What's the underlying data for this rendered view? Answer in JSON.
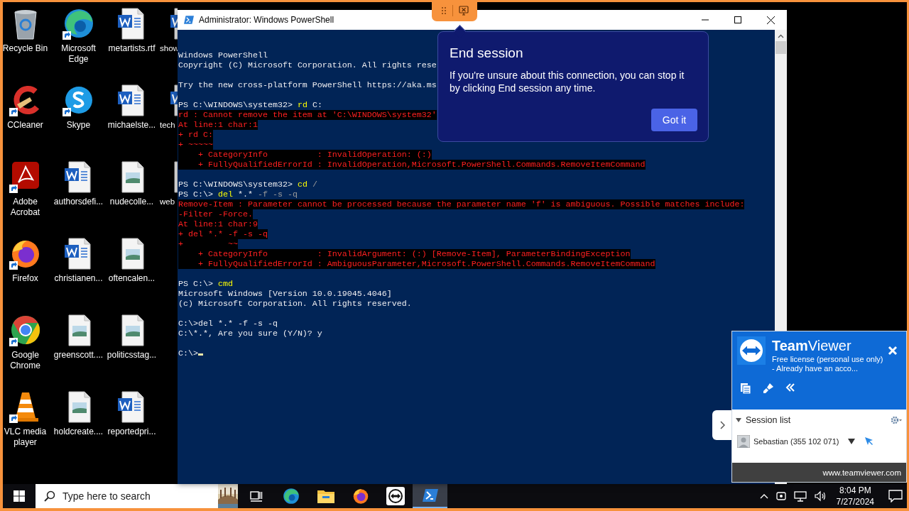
{
  "desktop": {
    "icons": [
      {
        "label": "Recycle Bin",
        "kind": "recycle",
        "shortcut": false
      },
      {
        "label": "CCleaner",
        "kind": "ccleaner",
        "shortcut": true
      },
      {
        "label": "Adobe Acrobat",
        "kind": "acrobat",
        "shortcut": true
      },
      {
        "label": "Firefox",
        "kind": "firefox",
        "shortcut": true
      },
      {
        "label": "Google Chrome",
        "kind": "chrome",
        "shortcut": true
      },
      {
        "label": "VLC media player",
        "kind": "vlc",
        "shortcut": true
      },
      {
        "label": "Microsoft Edge",
        "kind": "edge",
        "shortcut": true
      },
      {
        "label": "Skype",
        "kind": "skype",
        "shortcut": true
      },
      {
        "label": "authorsdefi...",
        "kind": "word",
        "shortcut": false
      },
      {
        "label": "christianen...",
        "kind": "word",
        "shortcut": false
      },
      {
        "label": "greenscott....",
        "shortcut": false
      },
      {
        "label": "holdcreate....",
        "shortcut": false
      },
      {
        "label": "metartists.rtf",
        "kind": "word",
        "shortcut": false
      },
      {
        "label": "michaelste...",
        "kind": "word",
        "shortcut": false
      },
      {
        "label": "nudecolle...",
        "shortcut": false
      },
      {
        "label": "oftencalen...",
        "shortcut": false
      },
      {
        "label": "politicsstag...",
        "shortcut": false
      },
      {
        "label": "reportedpri...",
        "kind": "word",
        "shortcut": false
      },
      {
        "label": "show",
        "kind": "word",
        "shortcut": false
      },
      {
        "label": "tech",
        "kind": "word",
        "shortcut": false
      },
      {
        "label": "web",
        "shortcut": false
      }
    ]
  },
  "powershell": {
    "title": "Administrator: Windows PowerShell",
    "cursor": true,
    "lines": [
      {
        "kind": "text",
        "spans": [
          {
            "text": "Windows PowerShell",
            "kind": "plain"
          }
        ]
      },
      {
        "kind": "text",
        "spans": [
          {
            "text": "Copyright (C) Microsoft Corporation. All rights rese",
            "kind": "plain"
          }
        ]
      },
      {
        "kind": "blank"
      },
      {
        "kind": "text",
        "spans": [
          {
            "text": "Try the new cross-platform PowerShell https://aka.ms",
            "kind": "plain"
          }
        ]
      },
      {
        "kind": "blank"
      },
      {
        "kind": "text",
        "spans": [
          {
            "text": "PS C:\\WINDOWS\\system32> ",
            "kind": "plain"
          },
          {
            "text": "rd",
            "kind": "command"
          },
          {
            "text": " C:",
            "kind": "plain"
          }
        ]
      },
      {
        "kind": "text",
        "spans": [
          {
            "text": "rd : Cannot remove the item at 'C:\\WINDOWS\\system32'",
            "kind": "error"
          }
        ]
      },
      {
        "kind": "text",
        "spans": [
          {
            "text": "At line:1 char:1",
            "kind": "error"
          }
        ]
      },
      {
        "kind": "text",
        "spans": [
          {
            "text": "+ rd C:",
            "kind": "error"
          }
        ]
      },
      {
        "kind": "text",
        "spans": [
          {
            "text": "+ ~~~~~",
            "kind": "error"
          }
        ]
      },
      {
        "kind": "text",
        "spans": [
          {
            "text": "    + CategoryInfo          : InvalidOperation: (:)",
            "kind": "error"
          }
        ]
      },
      {
        "kind": "text",
        "spans": [
          {
            "text": "    + FullyQualifiedErrorId : InvalidOperation,Microsoft.PowerShell.Commands.RemoveItemCommand",
            "kind": "error"
          }
        ]
      },
      {
        "kind": "blank"
      },
      {
        "kind": "text",
        "spans": [
          {
            "text": "PS C:\\WINDOWS\\system32> ",
            "kind": "plain"
          },
          {
            "text": "cd",
            "kind": "command"
          },
          {
            "text": " /",
            "kind": "arg"
          }
        ]
      },
      {
        "kind": "text",
        "spans": [
          {
            "text": "PS C:\\> ",
            "kind": "plain"
          },
          {
            "text": "del",
            "kind": "command"
          },
          {
            "text": " *.*",
            "kind": "plain"
          },
          {
            "text": " -f -s -q",
            "kind": "arg"
          }
        ]
      },
      {
        "kind": "text",
        "spans": [
          {
            "text": "Remove-Item : Parameter cannot be processed because the parameter name 'f' is ambiguous. Possible matches include:",
            "kind": "error"
          }
        ]
      },
      {
        "kind": "text",
        "spans": [
          {
            "text": "-Filter -Force.",
            "kind": "error"
          }
        ]
      },
      {
        "kind": "text",
        "spans": [
          {
            "text": "At line:1 char:9",
            "kind": "error"
          }
        ]
      },
      {
        "kind": "text",
        "spans": [
          {
            "text": "+ del *.* -f -s -q",
            "kind": "error"
          }
        ]
      },
      {
        "kind": "text",
        "spans": [
          {
            "text": "+         ~~",
            "kind": "error"
          }
        ]
      },
      {
        "kind": "text",
        "spans": [
          {
            "text": "    + CategoryInfo          : InvalidArgument: (:) [Remove-Item], ParameterBindingException",
            "kind": "error"
          }
        ]
      },
      {
        "kind": "text",
        "spans": [
          {
            "text": "    + FullyQualifiedErrorId : AmbiguousParameter,Microsoft.PowerShell.Commands.RemoveItemCommand",
            "kind": "error"
          }
        ]
      },
      {
        "kind": "blank"
      },
      {
        "kind": "text",
        "spans": [
          {
            "text": "PS C:\\> ",
            "kind": "plain"
          },
          {
            "text": "cmd",
            "kind": "command"
          }
        ]
      },
      {
        "kind": "text",
        "spans": [
          {
            "text": "Microsoft Windows [Version 10.0.19045.4046]",
            "kind": "plain"
          }
        ]
      },
      {
        "kind": "text",
        "spans": [
          {
            "text": "(c) Microsoft Corporation. All rights reserved.",
            "kind": "plain"
          }
        ]
      },
      {
        "kind": "blank"
      },
      {
        "kind": "text",
        "spans": [
          {
            "text": "C:\\>del *.* -f -s -q",
            "kind": "plain"
          }
        ]
      },
      {
        "kind": "text",
        "spans": [
          {
            "text": "C:\\*.*, Are you sure (Y/N)? y",
            "kind": "plain"
          }
        ]
      },
      {
        "kind": "blank"
      },
      {
        "kind": "text",
        "spans": [
          {
            "text": "C:\\>",
            "kind": "plain"
          }
        ]
      }
    ]
  },
  "end_session_popup": {
    "title": "End session",
    "body": "If you're unsure about this connection, you can stop it by clicking End session any time.",
    "button": "Got it"
  },
  "teamviewer": {
    "title": "**Team**Viewer",
    "subtitle": "Free license (personal use only) - Already have an acco...",
    "session_list": {
      "heading": "Session list",
      "expanded": true,
      "sessions": [
        {
          "name": "Sebastian (355 102 071)"
        }
      ]
    },
    "footer": "www.teamviewer.com"
  },
  "taskbar": {
    "search_placeholder": "Type here to search",
    "apps": [
      {
        "kind": "taskview",
        "selected": false
      },
      {
        "kind": "edge",
        "selected": false
      },
      {
        "kind": "explorer",
        "selected": false
      },
      {
        "kind": "firefox",
        "selected": false
      },
      {
        "kind": "teamviewer",
        "selected": false
      },
      {
        "kind": "powershell",
        "selected": true
      }
    ],
    "time": "8:04 PM",
    "date": "7/27/2024"
  }
}
